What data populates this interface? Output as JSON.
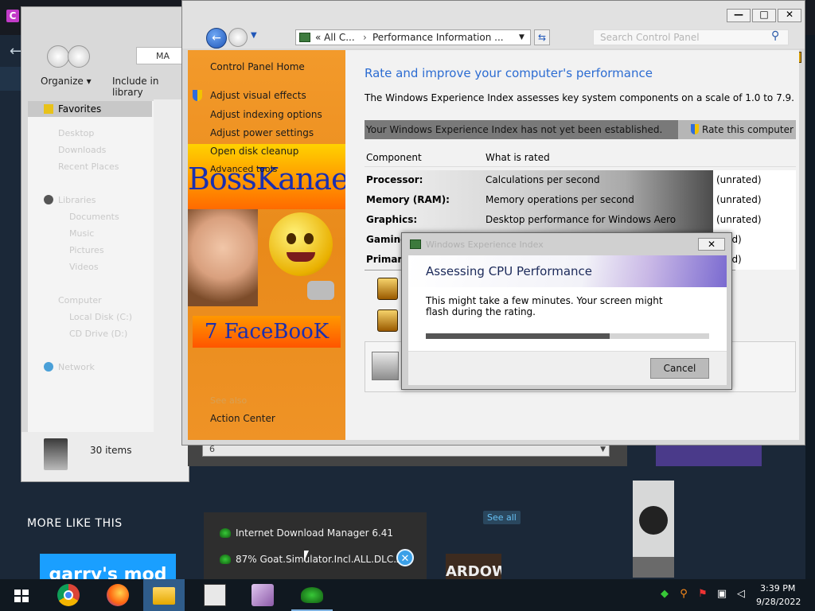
{
  "steam": {
    "section_title": "MORE LIKE THIS",
    "see_all": "See all",
    "tile1": "garry's mod",
    "tile2": "ARDOWN"
  },
  "explorer": {
    "toolbar": {
      "organize": "Organize",
      "include": "Include in library"
    },
    "address": "MA",
    "nav": {
      "favorites": "Favorites",
      "desktop": "Desktop",
      "downloads": "Downloads",
      "recent": "Recent Places",
      "libraries": "Libraries",
      "documents": "Documents",
      "music": "Music",
      "pictures": "Pictures",
      "videos": "Videos",
      "computer": "Computer",
      "local_disk": "Local Disk (C:)",
      "cd_drive": "CD Drive (D:)",
      "network": "Network"
    },
    "status": "30 items"
  },
  "cp": {
    "address": {
      "crumb1": "All C...",
      "sep": "›",
      "crumb2": "Performance Information ..."
    },
    "search_placeholder": "Search Control Panel",
    "left_links": {
      "home": "Control Panel Home",
      "visual": "Adjust visual effects",
      "indexing": "Adjust indexing options",
      "power": "Adjust power settings",
      "disk": "Open disk cleanup",
      "advanced": "Advanced tools",
      "see_also": "See also",
      "action_center": "Action Center"
    },
    "wallpaper": {
      "name": "BossKanae",
      "fb": "7 FaceBooK"
    },
    "title": "Rate and improve your computer's performance",
    "description": "The Windows Experience Index assesses key system components on a scale of 1.0 to 7.9.",
    "wei_message": "Your Windows Experience Index has not yet been established.",
    "rate_button": "Rate this computer",
    "table": {
      "headers": [
        "Component",
        "What is rated"
      ],
      "rows": [
        {
          "component": "Processor:",
          "what": "Calculations per second",
          "score": "(unrated)"
        },
        {
          "component": "Memory (RAM):",
          "what": "Memory operations per second",
          "score": "(unrated)"
        },
        {
          "component": "Graphics:",
          "what": "Desktop performance for Windows Aero",
          "score": "(unrated)"
        },
        {
          "component": "Gaming",
          "what": "",
          "score": "ated)"
        },
        {
          "component": "Primary",
          "what": "",
          "score": "ated)"
        }
      ]
    },
    "strip_value": "6"
  },
  "dialog": {
    "title": "Windows Experience Index",
    "close": "✕",
    "heading": "Assessing CPU Performance",
    "message": "This might take a few minutes. Your screen might flash during the rating.",
    "progress": 0.65,
    "cancel": "Cancel"
  },
  "idm": {
    "line1": "Internet Download Manager 6.41",
    "line2": "87% Goat.Simulator.Incl.ALL.DLC.zip",
    "close": "✕"
  },
  "taskbar": {
    "time": "3:39 PM",
    "date": "9/28/2022"
  },
  "window_buttons": {
    "minimize": "—",
    "maximize": "□",
    "close": "✕"
  }
}
